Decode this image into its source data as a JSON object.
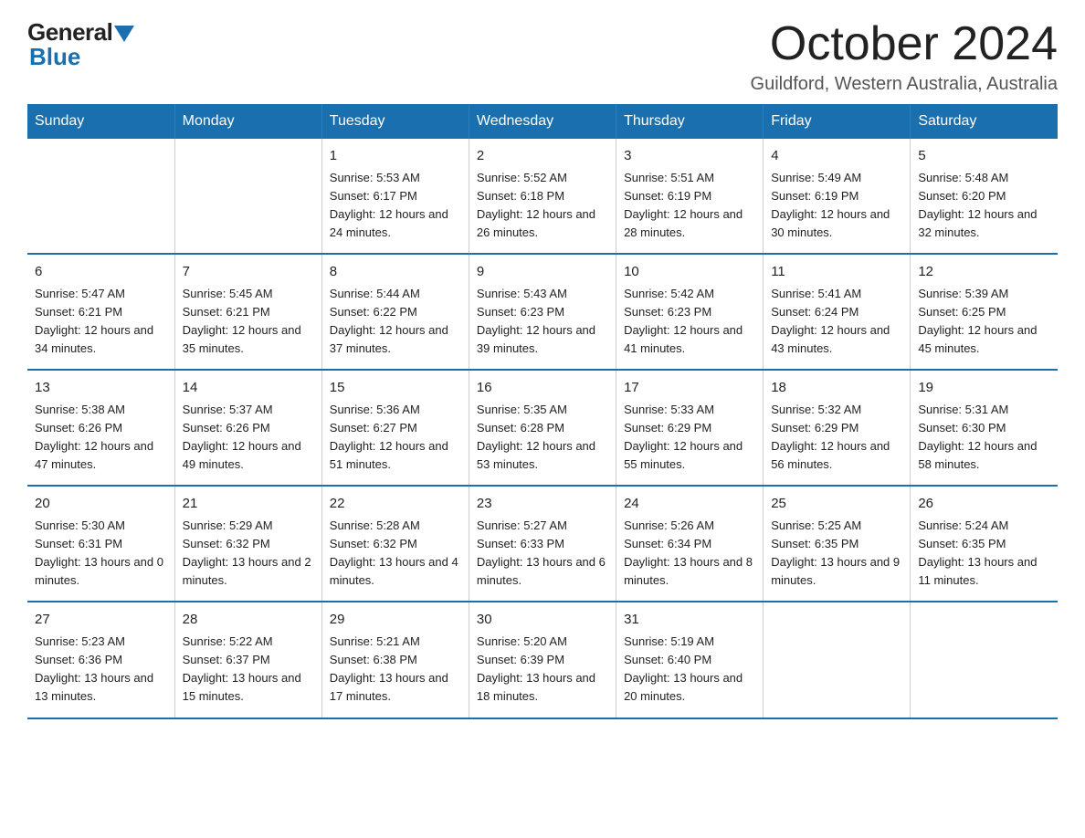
{
  "header": {
    "logo_general": "General",
    "logo_blue": "Blue",
    "month_title": "October 2024",
    "location": "Guildford, Western Australia, Australia"
  },
  "days_of_week": [
    "Sunday",
    "Monday",
    "Tuesday",
    "Wednesday",
    "Thursday",
    "Friday",
    "Saturday"
  ],
  "weeks": [
    {
      "days": [
        {
          "number": "",
          "info": ""
        },
        {
          "number": "",
          "info": ""
        },
        {
          "number": "1",
          "info": "Sunrise: 5:53 AM\nSunset: 6:17 PM\nDaylight: 12 hours\nand 24 minutes."
        },
        {
          "number": "2",
          "info": "Sunrise: 5:52 AM\nSunset: 6:18 PM\nDaylight: 12 hours\nand 26 minutes."
        },
        {
          "number": "3",
          "info": "Sunrise: 5:51 AM\nSunset: 6:19 PM\nDaylight: 12 hours\nand 28 minutes."
        },
        {
          "number": "4",
          "info": "Sunrise: 5:49 AM\nSunset: 6:19 PM\nDaylight: 12 hours\nand 30 minutes."
        },
        {
          "number": "5",
          "info": "Sunrise: 5:48 AM\nSunset: 6:20 PM\nDaylight: 12 hours\nand 32 minutes."
        }
      ]
    },
    {
      "days": [
        {
          "number": "6",
          "info": "Sunrise: 5:47 AM\nSunset: 6:21 PM\nDaylight: 12 hours\nand 34 minutes."
        },
        {
          "number": "7",
          "info": "Sunrise: 5:45 AM\nSunset: 6:21 PM\nDaylight: 12 hours\nand 35 minutes."
        },
        {
          "number": "8",
          "info": "Sunrise: 5:44 AM\nSunset: 6:22 PM\nDaylight: 12 hours\nand 37 minutes."
        },
        {
          "number": "9",
          "info": "Sunrise: 5:43 AM\nSunset: 6:23 PM\nDaylight: 12 hours\nand 39 minutes."
        },
        {
          "number": "10",
          "info": "Sunrise: 5:42 AM\nSunset: 6:23 PM\nDaylight: 12 hours\nand 41 minutes."
        },
        {
          "number": "11",
          "info": "Sunrise: 5:41 AM\nSunset: 6:24 PM\nDaylight: 12 hours\nand 43 minutes."
        },
        {
          "number": "12",
          "info": "Sunrise: 5:39 AM\nSunset: 6:25 PM\nDaylight: 12 hours\nand 45 minutes."
        }
      ]
    },
    {
      "days": [
        {
          "number": "13",
          "info": "Sunrise: 5:38 AM\nSunset: 6:26 PM\nDaylight: 12 hours\nand 47 minutes."
        },
        {
          "number": "14",
          "info": "Sunrise: 5:37 AM\nSunset: 6:26 PM\nDaylight: 12 hours\nand 49 minutes."
        },
        {
          "number": "15",
          "info": "Sunrise: 5:36 AM\nSunset: 6:27 PM\nDaylight: 12 hours\nand 51 minutes."
        },
        {
          "number": "16",
          "info": "Sunrise: 5:35 AM\nSunset: 6:28 PM\nDaylight: 12 hours\nand 53 minutes."
        },
        {
          "number": "17",
          "info": "Sunrise: 5:33 AM\nSunset: 6:29 PM\nDaylight: 12 hours\nand 55 minutes."
        },
        {
          "number": "18",
          "info": "Sunrise: 5:32 AM\nSunset: 6:29 PM\nDaylight: 12 hours\nand 56 minutes."
        },
        {
          "number": "19",
          "info": "Sunrise: 5:31 AM\nSunset: 6:30 PM\nDaylight: 12 hours\nand 58 minutes."
        }
      ]
    },
    {
      "days": [
        {
          "number": "20",
          "info": "Sunrise: 5:30 AM\nSunset: 6:31 PM\nDaylight: 13 hours\nand 0 minutes."
        },
        {
          "number": "21",
          "info": "Sunrise: 5:29 AM\nSunset: 6:32 PM\nDaylight: 13 hours\nand 2 minutes."
        },
        {
          "number": "22",
          "info": "Sunrise: 5:28 AM\nSunset: 6:32 PM\nDaylight: 13 hours\nand 4 minutes."
        },
        {
          "number": "23",
          "info": "Sunrise: 5:27 AM\nSunset: 6:33 PM\nDaylight: 13 hours\nand 6 minutes."
        },
        {
          "number": "24",
          "info": "Sunrise: 5:26 AM\nSunset: 6:34 PM\nDaylight: 13 hours\nand 8 minutes."
        },
        {
          "number": "25",
          "info": "Sunrise: 5:25 AM\nSunset: 6:35 PM\nDaylight: 13 hours\nand 9 minutes."
        },
        {
          "number": "26",
          "info": "Sunrise: 5:24 AM\nSunset: 6:35 PM\nDaylight: 13 hours\nand 11 minutes."
        }
      ]
    },
    {
      "days": [
        {
          "number": "27",
          "info": "Sunrise: 5:23 AM\nSunset: 6:36 PM\nDaylight: 13 hours\nand 13 minutes."
        },
        {
          "number": "28",
          "info": "Sunrise: 5:22 AM\nSunset: 6:37 PM\nDaylight: 13 hours\nand 15 minutes."
        },
        {
          "number": "29",
          "info": "Sunrise: 5:21 AM\nSunset: 6:38 PM\nDaylight: 13 hours\nand 17 minutes."
        },
        {
          "number": "30",
          "info": "Sunrise: 5:20 AM\nSunset: 6:39 PM\nDaylight: 13 hours\nand 18 minutes."
        },
        {
          "number": "31",
          "info": "Sunrise: 5:19 AM\nSunset: 6:40 PM\nDaylight: 13 hours\nand 20 minutes."
        },
        {
          "number": "",
          "info": ""
        },
        {
          "number": "",
          "info": ""
        }
      ]
    }
  ]
}
